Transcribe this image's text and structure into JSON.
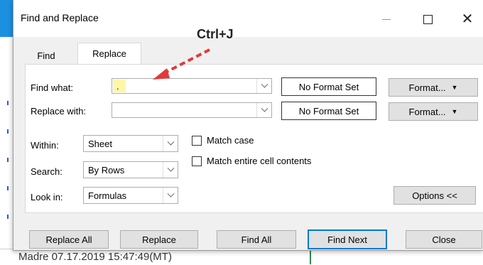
{
  "dialog": {
    "title": "Find and Replace",
    "annotation": "Ctrl+J",
    "tabs": {
      "find": "Find",
      "replace": "Replace"
    },
    "find_what": {
      "label": "Find what:",
      "value": "."
    },
    "replace_with": {
      "label": "Replace with:",
      "value": ""
    },
    "no_format_label": "No Format Set",
    "format_label": "Format...",
    "within": {
      "label": "Within:",
      "value": "Sheet"
    },
    "search": {
      "label": "Search:",
      "value": "By Rows"
    },
    "look_in": {
      "label": "Look in:",
      "value": "Formulas"
    },
    "match_case": "Match case",
    "match_entire": "Match entire cell contents",
    "options_label": "Options <<",
    "buttons": {
      "replace_all": "Replace All",
      "replace": "Replace",
      "find_all": "Find All",
      "find_next": "Find Next",
      "close": "Close"
    }
  },
  "background": {
    "bottom_row_text": "Madre    07.17.2019 15:47:49(MT)"
  },
  "colors": {
    "accent": "#0078d7",
    "annotation_arrow": "#e23a3a",
    "highlight": "#fff6a8"
  }
}
